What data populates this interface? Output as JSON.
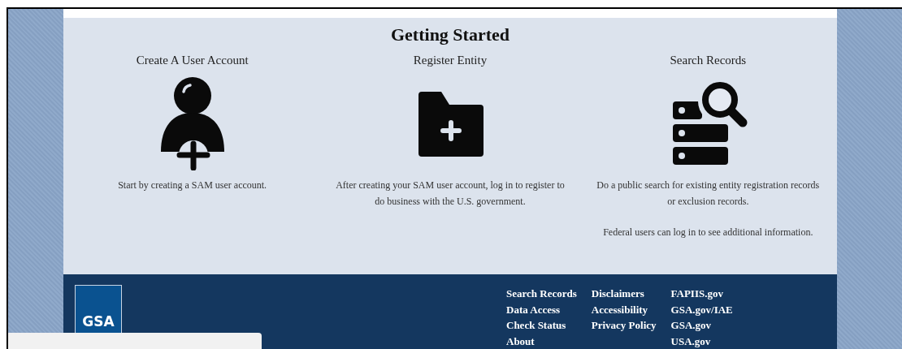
{
  "section": {
    "title": "Getting Started",
    "cards": [
      {
        "kind": "user",
        "heading": "Create A User Account",
        "texts": [
          "Start by creating a SAM user account."
        ]
      },
      {
        "kind": "folder",
        "heading": "Register Entity",
        "texts": [
          "After creating your SAM user account, log in to register to do business with the U.S. government."
        ]
      },
      {
        "kind": "search",
        "heading": "Search Records",
        "texts": [
          "Do a public search for existing entity registration records or exclusion records.",
          "Federal users can log in to see additional information."
        ]
      }
    ]
  },
  "footer": {
    "logo": "GSA",
    "link_columns": [
      [
        "Search Records",
        "Data Access",
        "Check Status",
        "About"
      ],
      [
        "Disclaimers",
        "Accessibility",
        "Privacy Policy"
      ],
      [
        "FAPIIS.gov",
        "GSA.gov/IAE",
        "GSA.gov",
        "USA.gov"
      ]
    ]
  }
}
